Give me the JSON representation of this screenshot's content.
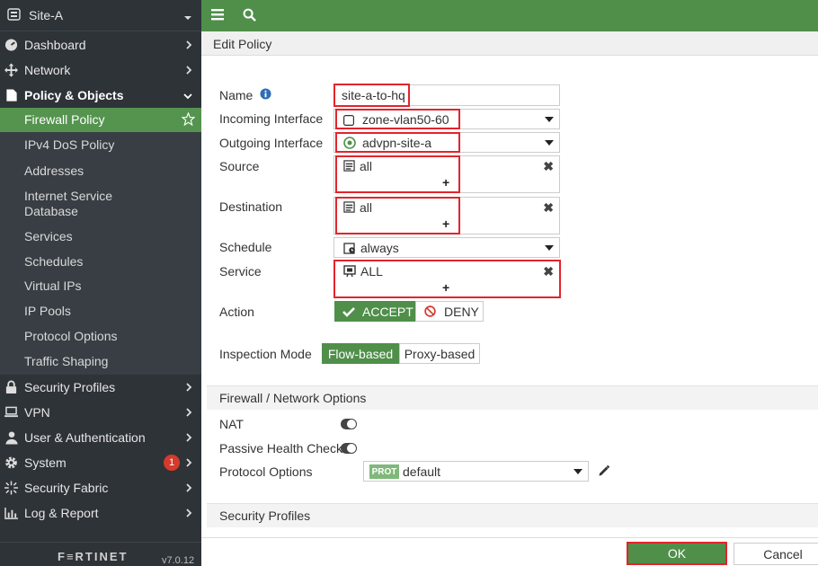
{
  "sidebar": {
    "device_name": "Site-A",
    "items": [
      {
        "label": "Dashboard"
      },
      {
        "label": "Network"
      },
      {
        "label": "Policy & Objects"
      }
    ],
    "policy_subitems": [
      {
        "label": "Firewall Policy"
      },
      {
        "label": "IPv4 DoS Policy"
      },
      {
        "label": "Addresses"
      },
      {
        "label": "Internet Service Database"
      },
      {
        "label": "Services"
      },
      {
        "label": "Schedules"
      },
      {
        "label": "Virtual IPs"
      },
      {
        "label": "IP Pools"
      },
      {
        "label": "Protocol Options"
      },
      {
        "label": "Traffic Shaping"
      }
    ],
    "bottom_items": [
      {
        "label": "Security Profiles"
      },
      {
        "label": "VPN"
      },
      {
        "label": "User & Authentication"
      },
      {
        "label": "System",
        "badge": "1"
      },
      {
        "label": "Security Fabric"
      },
      {
        "label": "Log & Report"
      }
    ],
    "brand": "F≡RTINET",
    "version": "v7.0.12"
  },
  "page": {
    "title": "Edit Policy"
  },
  "form": {
    "name_label": "Name",
    "name_value": "site-a-to-hq",
    "incoming_label": "Incoming Interface",
    "incoming_value": "zone-vlan50-60",
    "outgoing_label": "Outgoing Interface",
    "outgoing_value": "advpn-site-a",
    "source_label": "Source",
    "source_value": "all",
    "destination_label": "Destination",
    "destination_value": "all",
    "schedule_label": "Schedule",
    "schedule_value": "always",
    "service_label": "Service",
    "service_value": "ALL",
    "action_label": "Action",
    "accept_label": "ACCEPT",
    "deny_label": "DENY",
    "inspection_label": "Inspection Mode",
    "flow_label": "Flow-based",
    "proxy_label": "Proxy-based",
    "plus_symbol": "+"
  },
  "fw_options": {
    "section_title": "Firewall / Network Options",
    "nat_label": "NAT",
    "phc_label": "Passive Health Check",
    "proto_label": "Protocol Options",
    "proto_badge": "PROT",
    "proto_value": "default"
  },
  "security_profiles": {
    "section_title": "Security Profiles"
  },
  "footer": {
    "ok_label": "OK",
    "cancel_label": "Cancel"
  },
  "colors": {
    "brand_green": "#4f8f4a",
    "active_green": "#54944f",
    "highlight_red": "#e3242b",
    "sidebar_bg": "#2e3338"
  }
}
